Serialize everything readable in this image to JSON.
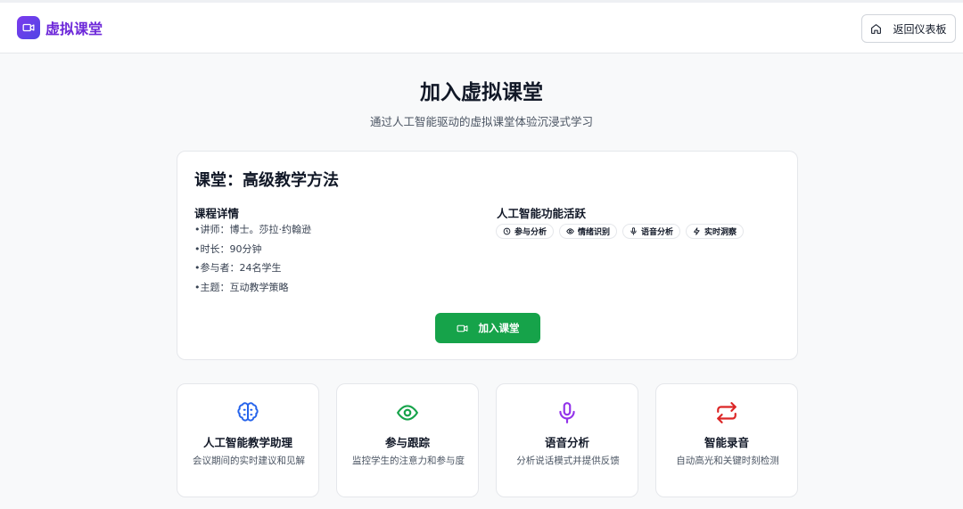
{
  "header": {
    "app_name": "虚拟课堂",
    "back_label": "返回仪表板",
    "icons": {
      "logo": "video-camera-icon",
      "back": "home-icon"
    },
    "accent_color": "#6d28d9"
  },
  "main": {
    "title": "加入虚拟课堂",
    "subtitle": "通过人工智能驱动的虚拟课堂体验沉浸式学习"
  },
  "class_card": {
    "title": "课堂：高级教学方法",
    "details_heading": "课程详情",
    "details": [
      "•讲师：博士。莎拉·约翰逊",
      "•时长：90分钟",
      "•参与者：24名学生",
      "•主题：互动教学策略"
    ],
    "ai_heading": "人工智能功能活跃",
    "ai_chips": [
      {
        "label": "参与分析",
        "icon": "activity-icon"
      },
      {
        "label": "情绪识别",
        "icon": "eye-icon"
      },
      {
        "label": "语音分析",
        "icon": "mic-icon"
      },
      {
        "label": "实时洞察",
        "icon": "zap-icon"
      }
    ],
    "join_label": "加入课堂",
    "join_color": "#16a34a"
  },
  "features": [
    {
      "title": "人工智能教学助理",
      "desc": "会议期间的实时建议和见解",
      "icon": "brain-icon",
      "color": "#2563eb"
    },
    {
      "title": "参与跟踪",
      "desc": "监控学生的注意力和参与度",
      "icon": "eye-icon",
      "color": "#16a34a"
    },
    {
      "title": "语音分析",
      "desc": "分析说话模式并提供反馈",
      "icon": "mic-icon",
      "color": "#9333ea"
    },
    {
      "title": "智能录音",
      "desc": "自动高光和关键时刻检测",
      "icon": "repeat-icon",
      "color": "#dc2626"
    }
  ]
}
